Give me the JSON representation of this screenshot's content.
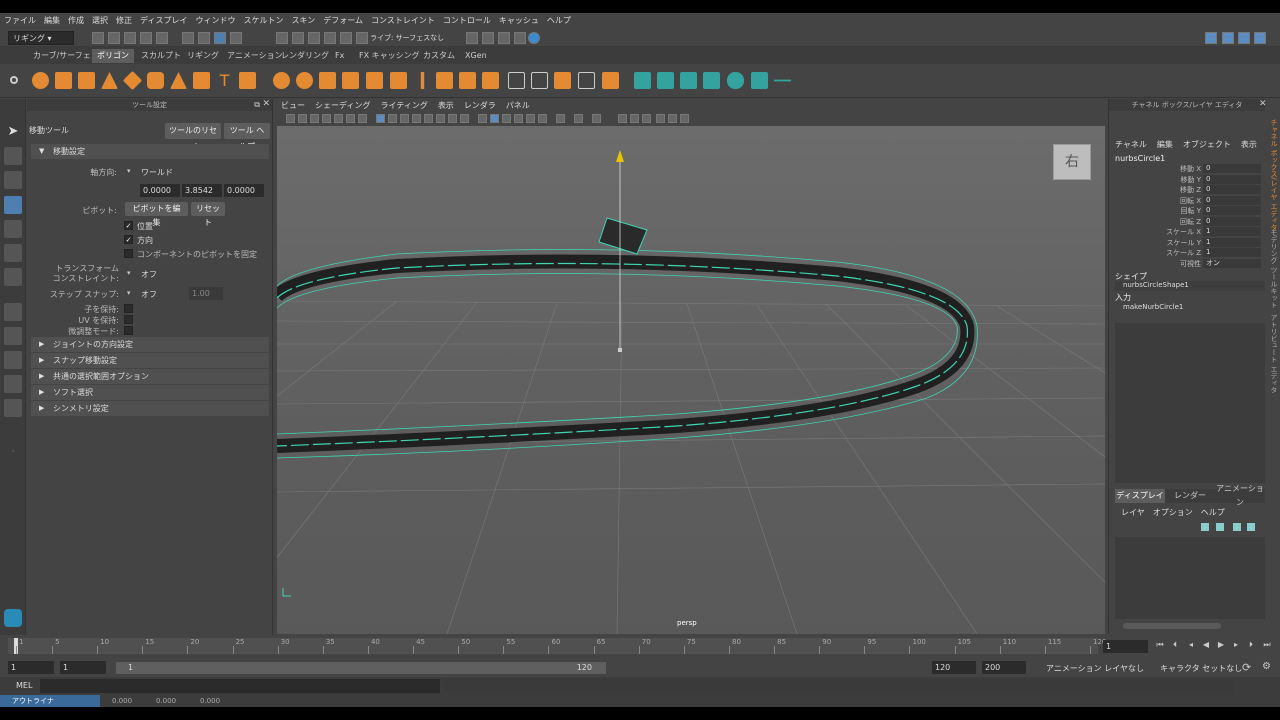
{
  "menubar": [
    "ファイル",
    "編集",
    "作成",
    "選択",
    "修正",
    "ディスプレイ",
    "ウィンドウ",
    "スケルトン",
    "スキン",
    "デフォーム",
    "コンストレイント",
    "コントロール",
    "キャッシュ",
    "ヘルプ"
  ],
  "statusline": {
    "menuset": "リギング",
    "live_label": "ライブ: サーフェスなし"
  },
  "shelf_tabs": [
    "カーブ/サーフェス",
    "ポリゴン",
    "スカルプト",
    "リギング",
    "アニメーション",
    "レンダリング",
    "Fx",
    "FX キャッシング",
    "カスタム",
    "XGen"
  ],
  "shelf_active": "ポリゴン",
  "tool_settings": {
    "panel_title": "ツール設定",
    "tool_name": "移動ツール",
    "reset_tool": "ツールのリセット",
    "tool_help": "ツール ヘルプ",
    "section_move": "移動設定",
    "axis_orient_label": "軸方向:",
    "axis_orient_value": "ワールド",
    "xyz": [
      "0.0000",
      "3.8542",
      "0.0000"
    ],
    "pivot_label": "ピボット:",
    "edit_pivot": "ピボットを編集",
    "reset": "リセット",
    "chk_position": "位置",
    "chk_orientation": "方向",
    "chk_component_pivot": "コンポーネントのピボットを固定",
    "transform_constraint_label1": "トランスフォーム",
    "transform_constraint_label2": "コンストレイント:",
    "transform_constraint_value": "オフ",
    "step_snap_label": "ステップ スナップ:",
    "step_snap_value": "オフ",
    "step_snap_num": "1.00",
    "preserve_children": "子を保持:",
    "preserve_uv": "UV を保持:",
    "tweak_mode": "微調整モード:",
    "sections": [
      "ジョイントの方向設定",
      "スナップ移動設定",
      "共通の選択範囲オプション",
      "ソフト選択",
      "シンメトリ設定"
    ]
  },
  "viewport": {
    "menus": [
      "ビュー",
      "シェーディング",
      "ライティング",
      "表示",
      "レンダラ",
      "パネル"
    ],
    "camera_label": "persp",
    "viewcube_label": "右"
  },
  "channel_box": {
    "title": "チャネル ボックス/レイヤ エディタ",
    "menus": [
      "チャネル",
      "編集",
      "オブジェクト",
      "表示"
    ],
    "object": "nurbsCircle1",
    "attrs": [
      {
        "name": "移動 X",
        "value": "0"
      },
      {
        "name": "移動 Y",
        "value": "0"
      },
      {
        "name": "移動 Z",
        "value": "0"
      },
      {
        "name": "回転 X",
        "value": "0"
      },
      {
        "name": "回転 Y",
        "value": "0"
      },
      {
        "name": "回転 Z",
        "value": "0"
      },
      {
        "name": "スケール X",
        "value": "1"
      },
      {
        "name": "スケール Y",
        "value": "1"
      },
      {
        "name": "スケール Z",
        "value": "1"
      },
      {
        "name": "可視性",
        "value": "オン"
      }
    ],
    "shapes_label": "シェイプ",
    "shape_name": "nurbsCircleShape1",
    "inputs_label": "入力",
    "input_name": "makeNurbCircle1",
    "layer_tabs": [
      "ディスプレイ",
      "レンダー",
      "アニメーション"
    ],
    "layer_menus": [
      "レイヤ",
      "オプション",
      "ヘルプ"
    ],
    "side_tabs": [
      "チャネル ボックス/レイヤ エディタ",
      "モデリング ツールキット",
      "アトリビュート エディタ"
    ]
  },
  "timeline": {
    "ticks": [
      "1",
      "5",
      "10",
      "15",
      "20",
      "25",
      "30",
      "35",
      "40",
      "45",
      "50",
      "55",
      "60",
      "65",
      "70",
      "75",
      "80",
      "85",
      "90",
      "95",
      "100",
      "105",
      "110",
      "115",
      "120"
    ],
    "current_frame": "1"
  },
  "range": {
    "start": "1",
    "inner_start": "1",
    "slider_start": "1",
    "slider_end": "120",
    "inner_end": "120",
    "end": "200",
    "anim_layer": "アニメーション レイヤなし",
    "char_set": "キャラクタ セットなし"
  },
  "cmdline": {
    "label": "MEL"
  },
  "helpline": {
    "outliner": "アウトライナ",
    "vals": [
      "0.000",
      "0.000",
      "0.000"
    ]
  },
  "colors": {
    "selection": "#3fd5b5",
    "accent_orange": "#e48a33",
    "active_blue": "#4f7fb0"
  }
}
